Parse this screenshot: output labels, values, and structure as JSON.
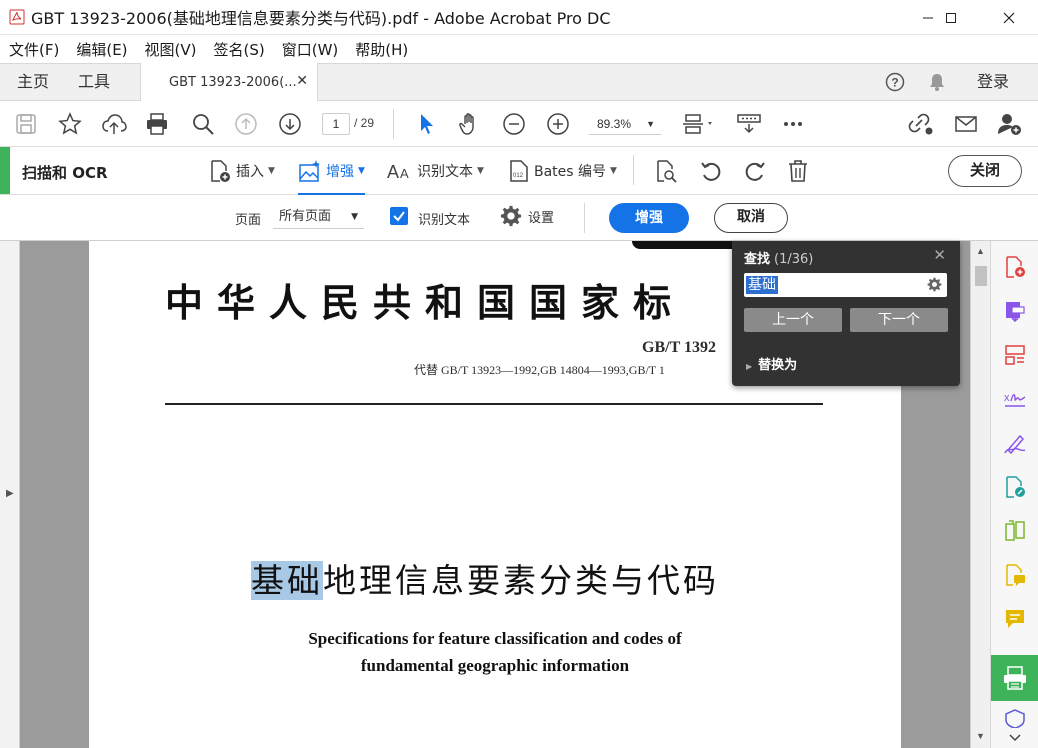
{
  "window": {
    "title": "GBT 13923-2006(基础地理信息要素分类与代码).pdf - Adobe Acrobat Pro DC"
  },
  "menu": [
    "文件(F)",
    "编辑(E)",
    "视图(V)",
    "签名(S)",
    "窗口(W)",
    "帮助(H)"
  ],
  "tabs": {
    "home": "主页",
    "tools": "工具",
    "document": "GBT 13923-2006(...",
    "login": "登录"
  },
  "toolbar": {
    "current_page": "1",
    "total_pages": "/ 29",
    "zoom": "89.3%"
  },
  "ocr_toolbar": {
    "tool_name": "扫描和 OCR",
    "insert": "插入",
    "enhance": "增强",
    "recognize_text": "识别文本",
    "bates": "Bates 编号",
    "close": "关闭"
  },
  "enhance_options": {
    "pages_label": "页面",
    "pages_value": "所有页面",
    "recognize_text_label": "识别文本",
    "recognize_text_checked": true,
    "settings_label": "设置",
    "enhance_button": "增强",
    "cancel_button": "取消"
  },
  "document": {
    "cn_standard_heading": "中华人民共和国国家标",
    "std_code": "GB/T 1392",
    "replaces": "代替 GB/T 13923—1992,GB 14804—1993,GB/T 1",
    "title_highlight": "基础",
    "title_rest": "地理信息要素分类与代码",
    "en_title_line1": "Specifications for feature classification and codes of",
    "en_title_line2": "fundamental geographic information"
  },
  "find_panel": {
    "title": "查找",
    "count": "(1/36)",
    "query": "基础",
    "prev": "上一个",
    "next": "下一个",
    "replace": "替换为"
  },
  "colors": {
    "accent_blue": "#1473e6",
    "tool_green": "#3fb35a",
    "highlight": "#a8c9e6"
  }
}
